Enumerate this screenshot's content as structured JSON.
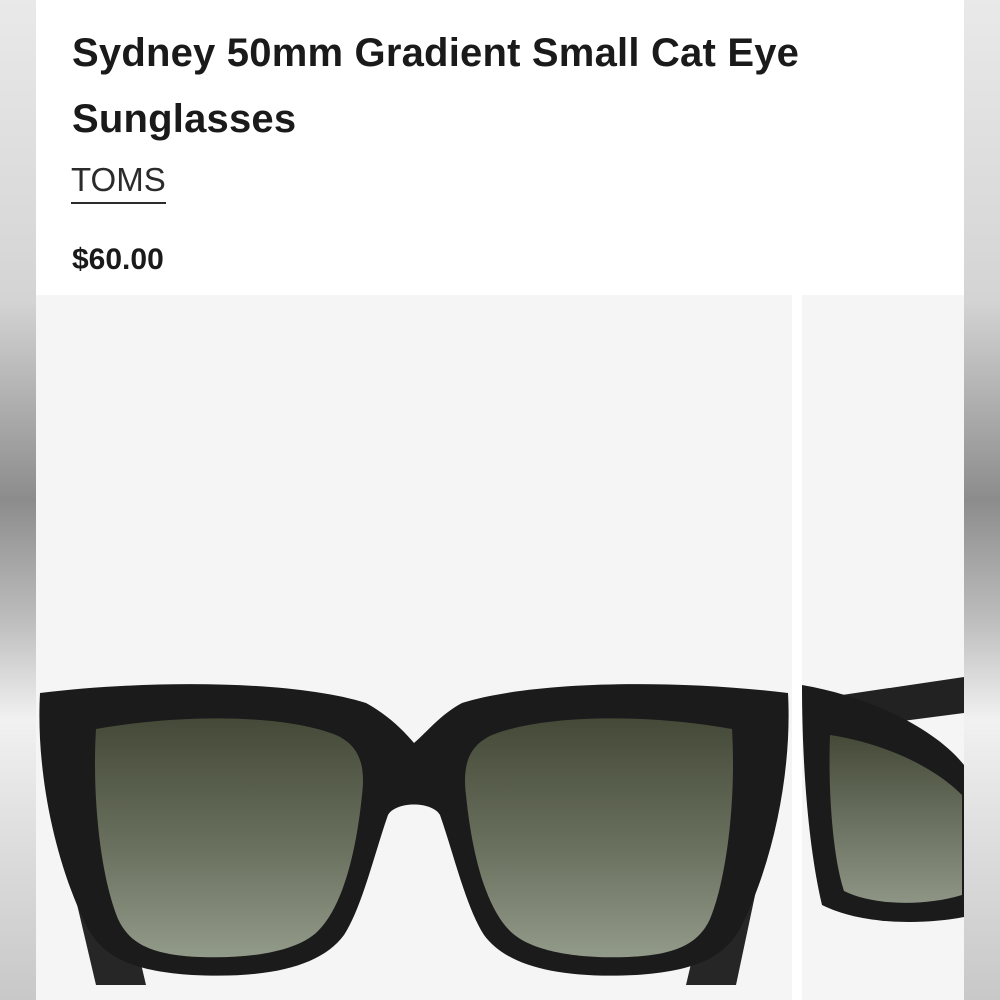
{
  "product": {
    "title": "Sydney 50mm Gradient Small Cat Eye Sunglasses",
    "brand": "TOMS",
    "price": "$60.00"
  },
  "gallery": {
    "images": [
      {
        "alt": "Sunglasses front view"
      },
      {
        "alt": "Sunglasses side view"
      }
    ]
  },
  "colors": {
    "text": "#1a1a1a",
    "image_background": "#f5f5f5",
    "frame": "#1b1b1b",
    "lens_top": "#4b4f3e",
    "lens_bottom": "#8c9484"
  }
}
